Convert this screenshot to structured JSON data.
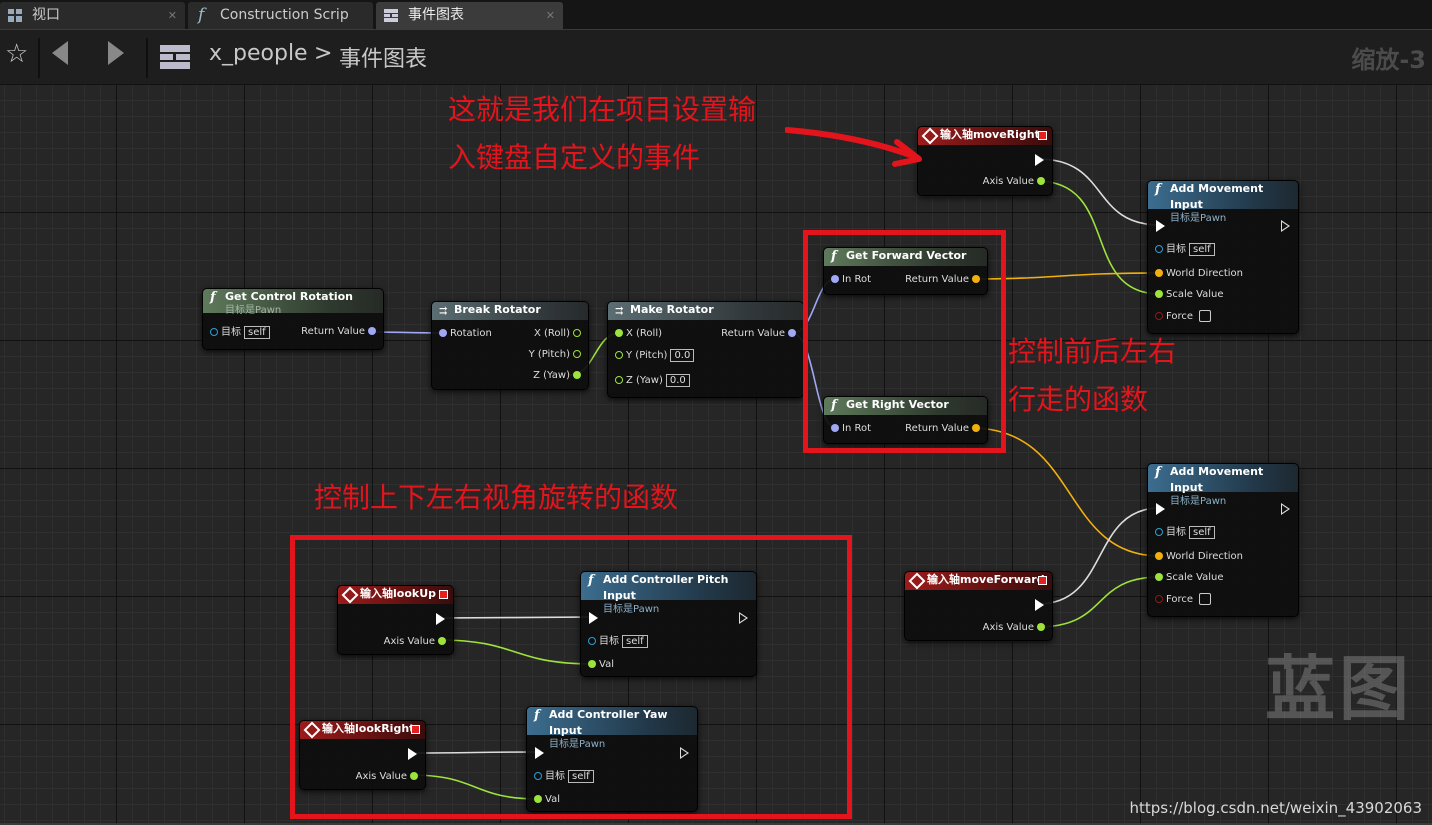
{
  "tabs": [
    {
      "label": "视口",
      "icon": "viewport-grid-icon",
      "active": false
    },
    {
      "label": "Construction Scrip",
      "icon": "function-icon",
      "active": false
    },
    {
      "label": "事件图表",
      "icon": "event-graph-icon",
      "active": true
    }
  ],
  "toolbar": {
    "blueprint": "x_people",
    "separator": ">",
    "graph": "事件图表",
    "zoom": "缩放-3"
  },
  "nodes": {
    "get_control_rotation": {
      "title": "Get Control Rotation",
      "sub": "目标是Pawn",
      "target": "目标",
      "self": "self",
      "ret": "Return Value"
    },
    "break_rotator": {
      "title": "Break Rotator",
      "rotation": "Rotation",
      "x": "X (Roll)",
      "y": "Y (Pitch)",
      "z": "Z (Yaw)"
    },
    "make_rotator": {
      "title": "Make Rotator",
      "x": "X (Roll)",
      "y": "Y (Pitch)",
      "z": "Z (Yaw)",
      "yv": "0.0",
      "zv": "0.0",
      "ret": "Return Value"
    },
    "get_forward": {
      "title": "Get Forward Vector",
      "inrot": "In Rot",
      "ret": "Return Value"
    },
    "get_right": {
      "title": "Get Right Vector",
      "inrot": "In Rot",
      "ret": "Return Value"
    },
    "move_right": {
      "title": "输入轴moveRight",
      "axis": "Axis Value"
    },
    "move_forward": {
      "title": "输入轴moveForward",
      "axis": "Axis Value"
    },
    "add_move_1": {
      "title": "Add Movement Input",
      "sub": "目标是Pawn",
      "target": "目标",
      "self": "self",
      "dir": "World Direction",
      "scale": "Scale Value",
      "force": "Force"
    },
    "add_move_2": {
      "title": "Add Movement Input",
      "sub": "目标是Pawn",
      "target": "目标",
      "self": "self",
      "dir": "World Direction",
      "scale": "Scale Value",
      "force": "Force"
    },
    "look_up": {
      "title": "输入轴lookUp",
      "axis": "Axis Value"
    },
    "look_right": {
      "title": "输入轴lookRight",
      "axis": "Axis Value"
    },
    "pitch": {
      "title": "Add Controller Pitch Input",
      "sub": "目标是Pawn",
      "target": "目标",
      "self": "self",
      "val": "Val"
    },
    "yaw": {
      "title": "Add Controller Yaw Input",
      "sub": "目标是Pawn",
      "target": "目标",
      "self": "self",
      "val": "Val"
    }
  },
  "annotations": {
    "a1_line1": "这就是我们在项目设置输",
    "a1_line2": "入键盘自定义的事件",
    "a2_line1": "控制前后左右",
    "a2_line2": "行走的函数",
    "a3": "控制上下左右视角旋转的函数"
  },
  "watermark": "蓝图",
  "url": "https://blog.csdn.net/weixin_43902063",
  "colors": {
    "annotation": "#e3141b",
    "exec": "#ffffff",
    "vector": "#f2b00f",
    "float": "#9de33c",
    "rotator": "#9fa8f5"
  }
}
